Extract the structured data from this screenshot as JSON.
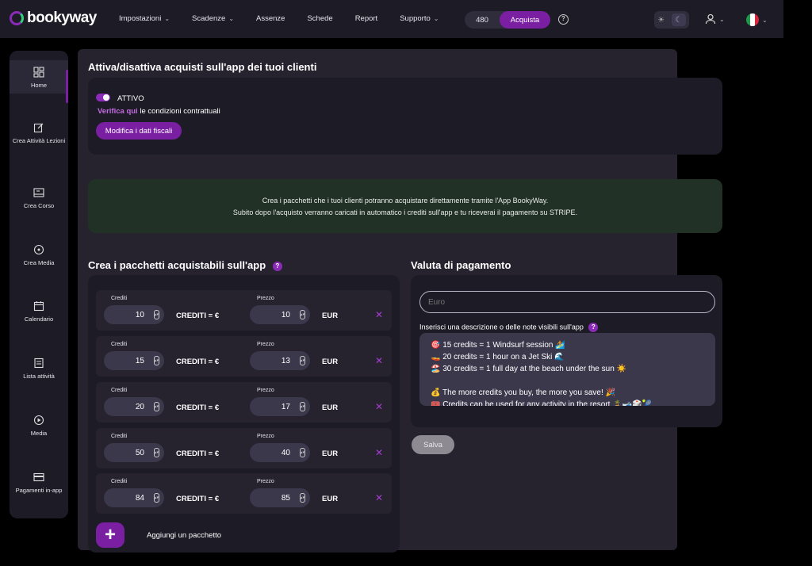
{
  "app": {
    "logo_text": "bookyway"
  },
  "nav": [
    {
      "label": "Impostazioni",
      "has_dropdown": true
    },
    {
      "label": "Scadenze",
      "has_dropdown": true
    },
    {
      "label": "Assenze",
      "has_dropdown": false
    },
    {
      "label": "Schede",
      "has_dropdown": false
    },
    {
      "label": "Report",
      "has_dropdown": false
    },
    {
      "label": "Supporto",
      "has_dropdown": true
    }
  ],
  "credits": {
    "count": "480",
    "buy_label": "Acquista"
  },
  "sidebar": {
    "items": [
      {
        "label": "Home",
        "icon": "dashboard-icon",
        "active": true
      },
      {
        "label": "Crea Attività Lezioni",
        "icon": "edit-icon"
      },
      {
        "label": "Crea Corso",
        "icon": "calendar-board-icon"
      },
      {
        "label": "Crea Media",
        "icon": "plus-circle-icon"
      },
      {
        "label": "Calendario",
        "icon": "calendar-icon"
      },
      {
        "label": "Lista attività",
        "icon": "list-icon"
      },
      {
        "label": "Media",
        "icon": "play-circle-icon"
      },
      {
        "label": "Pagamenti in-app",
        "icon": "credit-card-icon"
      }
    ]
  },
  "activation": {
    "title": "Attiva/disattiva acquisti sull'app dei tuoi clienti",
    "status": "ATTIVO",
    "verify_link": "Verifica qui",
    "verify_text": " le condizioni contrattuali",
    "tax_button": "Modifica i dati fiscali"
  },
  "info": {
    "line1": "Crea i pacchetti che i tuoi clienti potranno acquistare direttamente tramite l'App BookyWay.",
    "line2": "Subito dopo l'acquisto verranno caricati in automatico i crediti sull'app e tu riceverai il pagamento su STRIPE."
  },
  "packages": {
    "title": "Crea i pacchetti acquistabili sull'app",
    "credits_label": "Crediti",
    "price_label": "Prezzo",
    "credits_unit": "CREDITI = €",
    "currency": "EUR",
    "rows": [
      {
        "credits": "10",
        "price": "10"
      },
      {
        "credits": "15",
        "price": "13"
      },
      {
        "credits": "20",
        "price": "17"
      },
      {
        "credits": "50",
        "price": "40"
      },
      {
        "credits": "84",
        "price": "85"
      }
    ],
    "add_label": "Aggiungi un pacchetto"
  },
  "payment": {
    "title": "Valuta di pagamento",
    "currency_placeholder": "Euro",
    "desc_label": "Inserisci una descrizione o delle note visibili sull'app",
    "desc_lines": [
      "🎯 15 credits = 1 Windsurf session 🏄",
      "🚤 20 credits = 1 hour on a Jet Ski 🌊",
      "🏖️ 30 credits = 1 full day at the beach under the sun ☀️",
      "",
      "💰 The more credits you buy, the more you save! 🎉",
      "🎟️ Credits can be used for any activity in the resort 🏝️🎿🎲🎾"
    ],
    "save_label": "Salva"
  },
  "colors": {
    "accent": "#7b1fa2",
    "panel": "#1d1b26",
    "info_bg": "#223126"
  }
}
